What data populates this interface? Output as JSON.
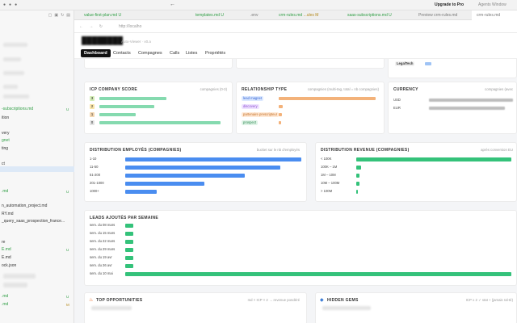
{
  "topbar": {
    "upgrade_label": "Upgrade to Pro",
    "agents_label": "Agents Window",
    "back_icon": "arrow-left-icon"
  },
  "sidebar": {
    "items": [
      {
        "label": "-subscriptions.md",
        "color": "green",
        "badge": "U"
      },
      {
        "label": "ition",
        "color": "normal",
        "badge": ""
      },
      {
        "label": "very",
        "color": "normal",
        "badge": ""
      },
      {
        "label": "gnet",
        "color": "green",
        "badge": ""
      },
      {
        "label": "ting",
        "color": "normal",
        "badge": ""
      },
      {
        "label": "ct",
        "color": "normal",
        "badge": ""
      },
      {
        "label": ".md",
        "color": "green",
        "badge": "U"
      },
      {
        "label": "n_automation_project.md",
        "color": "normal",
        "badge": ""
      },
      {
        "label": "RY.md",
        "color": "normal",
        "badge": ""
      },
      {
        "label": "_query_saas_prospection_france...",
        "color": "normal",
        "badge": ""
      },
      {
        "label": "re",
        "color": "normal",
        "badge": ""
      },
      {
        "label": "E.md",
        "color": "green",
        "badge": "U"
      },
      {
        "label": "E.md",
        "color": "normal",
        "badge": ""
      },
      {
        "label": "ock.json",
        "color": "normal",
        "badge": ""
      },
      {
        "label": ".md",
        "color": "green",
        "badge": "U"
      },
      {
        "label": ".md",
        "color": "green",
        "badge": "M"
      }
    ]
  },
  "tabs": [
    {
      "label": "value-first-plan.md",
      "badge": "U",
      "style": "green"
    },
    {
      "label": "templates.md",
      "badge": "U",
      "style": "green"
    },
    {
      "label": ".env",
      "badge": "",
      "style": "gray"
    },
    {
      "label": "crm-rules.md",
      "badge": "...ules M",
      "style": "green"
    },
    {
      "label": "saas-subscriptions.md",
      "badge": "U",
      "style": "green"
    },
    {
      "label": "Preview crm-rules.md",
      "badge": "",
      "style": "gray"
    },
    {
      "label": "crm-rules.md",
      "badge": "",
      "style": "gray"
    }
  ],
  "browser": {
    "url": "http://localho"
  },
  "app": {
    "subtitle": "Auto-Viewer · v0.a",
    "nav": [
      "Dashboard",
      "Contacts",
      "Compagnes",
      "Calls",
      "Listes",
      "Propriétés"
    ],
    "active_nav": "Dashboard"
  },
  "legaltech_chip": "LegalTech",
  "icp": {
    "title": "ICP COMPANY SCORE",
    "hint": "compagnies (0-3)",
    "rows": [
      {
        "score": "3",
        "value": 0.55,
        "color": "#d4ecb7"
      },
      {
        "score": "2",
        "value": 0.45,
        "color": "#f8e4a8"
      },
      {
        "score": "1",
        "value": 0.3,
        "color": "#f3d6b0"
      },
      {
        "score": "0",
        "value": 1.0,
        "color": "#e3e3e3"
      }
    ]
  },
  "relationship": {
    "title": "RELATIONSHIP TYPE",
    "hint": "compagnies (multi-tag, total = nb compagnies)",
    "rows": [
      {
        "label": "lead magnet",
        "chip_bg": "#dbe8ff",
        "chip_color": "#2f5fd0",
        "value": 1.0
      },
      {
        "label": "discovery",
        "chip_bg": "#efe1ff",
        "chip_color": "#8a4fd0",
        "value": 0.04
      },
      {
        "label": "partenaire prescripteur",
        "chip_bg": "#ffe9d6",
        "chip_color": "#c26b1e",
        "value": 0.03
      },
      {
        "label": "prospect",
        "chip_bg": "#dff3e6",
        "chip_color": "#2f8a55",
        "value": 0.02
      }
    ]
  },
  "currency": {
    "title": "CURRENCY",
    "hint": "compagnies (avec",
    "rows": [
      {
        "label": "USD",
        "value": 1.0
      },
      {
        "label": "EUR",
        "value": 0.9
      }
    ]
  },
  "employees": {
    "title": "DISTRIBUTION EMPLOYÉS (COMPAGNIES)",
    "hint": "bucket sur le nb d'employés",
    "rows": [
      {
        "label": "1-10",
        "value": 1.0
      },
      {
        "label": "11-50",
        "value": 0.88
      },
      {
        "label": "51-200",
        "value": 0.68
      },
      {
        "label": "201-1000",
        "value": 0.45
      },
      {
        "label": "1000+",
        "value": 0.18
      }
    ]
  },
  "revenue": {
    "title": "DISTRIBUTION REVENUE (COMPAGNIES)",
    "hint": "après conversion EU",
    "rows": [
      {
        "label": "< 100K",
        "value": 1.0
      },
      {
        "label": "100K – 1M",
        "value": 0.03
      },
      {
        "label": "1M – 10M",
        "value": 0.02
      },
      {
        "label": "10M – 100M",
        "value": 0.02
      },
      {
        "label": "> 100M",
        "value": 0.01
      }
    ]
  },
  "leads": {
    "title": "LEADS AJOUTÉS PAR SEMAINE",
    "rows": [
      {
        "label": "sem. du 08 mars",
        "value": 0.02
      },
      {
        "label": "sem. du 15 mars",
        "value": 0.02
      },
      {
        "label": "sem. du 22 mars",
        "value": 0.02
      },
      {
        "label": "sem. du 29 mars",
        "value": 0.02
      },
      {
        "label": "sem. du 19 avr",
        "value": 0.02
      },
      {
        "label": "sem. du 26 avr",
        "value": 0.02
      },
      {
        "label": "sem. du 10 mai",
        "value": 1.0
      }
    ]
  },
  "top_opps": {
    "title": "TOP OPPORTUNITIES",
    "hint": "md × ICP × 2 → revenue pondéré",
    "icon": "fire-icon"
  },
  "hidden_gems": {
    "title": "HIDDEN GEMS",
    "hint": "ICP ≥ 2 ✓ stat + (jamais ral-té)",
    "icon": "gem-icon"
  },
  "colors": {
    "blue_bar": "#4a8df0",
    "green_bar": "#34c27a",
    "orange_bar": "#f3b27a",
    "gray_bar": "#bdbdbd"
  }
}
